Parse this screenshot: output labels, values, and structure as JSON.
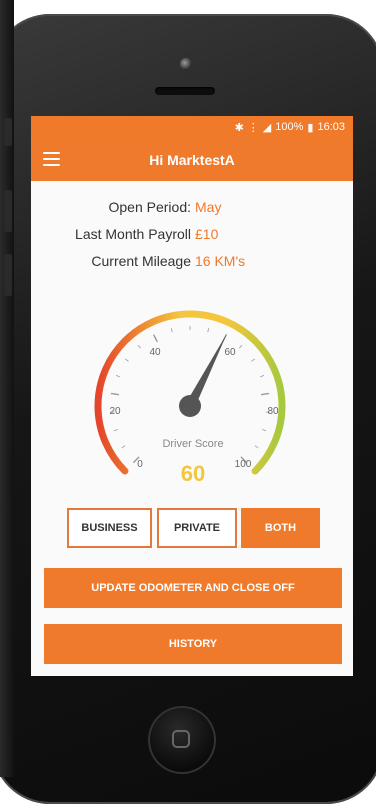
{
  "status_bar": {
    "icons": [
      "bluetooth-icon",
      "vibrate-icon",
      "signal-icon",
      "battery-icon"
    ],
    "battery": "100%",
    "time": "16:03"
  },
  "app_bar": {
    "title": "Hi MarktestA"
  },
  "info": {
    "open_period_label": "Open Period:",
    "open_period_value": "May",
    "payroll_label": "Last Month Payroll",
    "payroll_value": "£10",
    "mileage_label": "Current Mileage",
    "mileage_value": "16 KM's"
  },
  "gauge": {
    "caption": "Driver Score",
    "score": "60",
    "score_value": 60,
    "tick_labels": [
      "0",
      "20",
      "40",
      "60",
      "80",
      "100"
    ],
    "colors": {
      "low": "#e4452b",
      "mid": "#f4c63d",
      "high": "#a6c93e"
    }
  },
  "filters": {
    "business": "BUSINESS",
    "private": "PRIVATE",
    "both": "BOTH",
    "selected": "BOTH"
  },
  "actions": {
    "update": "UPDATE ODOMETER AND CLOSE OFF",
    "history": "HISTORY"
  },
  "colors": {
    "accent": "#ef7a2b"
  }
}
